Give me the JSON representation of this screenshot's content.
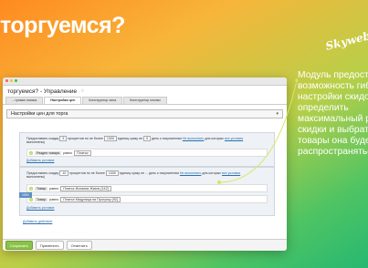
{
  "banner": {
    "headline": "торгуемся?",
    "logo": "Skyweb",
    "description_lines": [
      "Модуль предоста",
      "возможность гиб",
      "настройки скидо",
      "определить",
      "максимальный р",
      "скидки и выбрат",
      "товары она будет",
      "распространятьс"
    ]
  },
  "window": {
    "title": "торгуемся? - Управление",
    "tabs": [
      "...тровка поиска",
      "Настройки цен",
      "Конструктор окна",
      "Конструктор кнопки"
    ],
    "section_title": "Настройки цен для торга",
    "condition1": {
      "text_before": "Предоставить скидку",
      "value1": "5",
      "text_mid1": "процентов",
      "text_mid2": "но не более",
      "value2": "1000",
      "text_mid3": "единиц",
      "text_mid4": "сразу",
      "text_mid5": "не",
      "value3": "5",
      "text_mid6": "день",
      "text_mid7": "к покупателям",
      "link1": "Не выполнять",
      "text_mid8": "для которых",
      "link2": "все условия",
      "text_end": "выполнены)",
      "sub_label": "Раздел товара",
      "sub_op": "равно",
      "sub_value": "Платья",
      "add_condition": "Добавить условие"
    },
    "condition2": {
      "text_before": "Предоставить скидку",
      "value1": "10",
      "text_mid1": "процентов",
      "text_mid2": "но не более",
      "value2": "1000",
      "text_mid3": "единиц",
      "text_mid4": "сразу",
      "text_mid5": "не ...",
      "text_mid6": "день",
      "text_mid7": "к покупателям",
      "link1": "Не выполнять",
      "text_mid8": "для которых",
      "link2": "все условия",
      "text_end": "выполнены)",
      "or_label": "ИЛИ",
      "sub1_label": "Товар",
      "sub1_op": "равно",
      "sub1_value": "Платье Испания Жизнь [142]",
      "sub2_label": "Товар",
      "sub2_op": "равно",
      "sub2_value": "Платье Медуница на Прогулку [92]",
      "add_condition": "Добавить условие"
    },
    "add_action": "Добавить действие",
    "buttons": {
      "save": "Сохранить",
      "apply": "Применить",
      "cancel": "Отменить"
    }
  },
  "colors": {
    "accent_green": "#8bc34a",
    "link_blue": "#2a6fb0",
    "connector": "#d4e86a"
  }
}
